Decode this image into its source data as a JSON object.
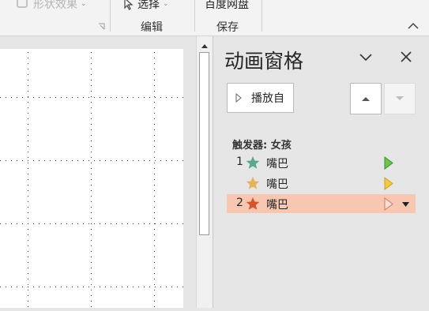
{
  "ribbon": {
    "shape_effects": "形状效果",
    "select": "选择",
    "baidu_netdisk": "百度网盘",
    "group_edit": "编辑",
    "group_save": "保存"
  },
  "pane": {
    "title": "动画窗格",
    "play_from": "播放自",
    "trigger": "触发器: 女孩",
    "items": [
      {
        "number": "1",
        "name": "嘴巴",
        "star_color": "#5aa793",
        "timeline_color": "#6cc24a",
        "selected": false
      },
      {
        "number": "",
        "name": "嘴巴",
        "star_color": "#e7b35a",
        "timeline_color": "#f2c744",
        "selected": false
      },
      {
        "number": "2",
        "name": "嘴巴",
        "star_color": "#d6532e",
        "timeline_color": "#f1aa9a",
        "selected": true
      }
    ]
  },
  "colors": {
    "selection": "#f8c7b1",
    "pane_bg": "#e6e6e6"
  },
  "icons": {
    "shape_effects": "shape-effects-icon",
    "select": "cursor-arrow-icon",
    "play": "play-triangle-icon",
    "move_up": "move-up-icon",
    "move_down": "move-down-icon",
    "dropdown": "chevron-down-icon",
    "close": "close-icon",
    "collapse": "chevron-up-icon"
  }
}
